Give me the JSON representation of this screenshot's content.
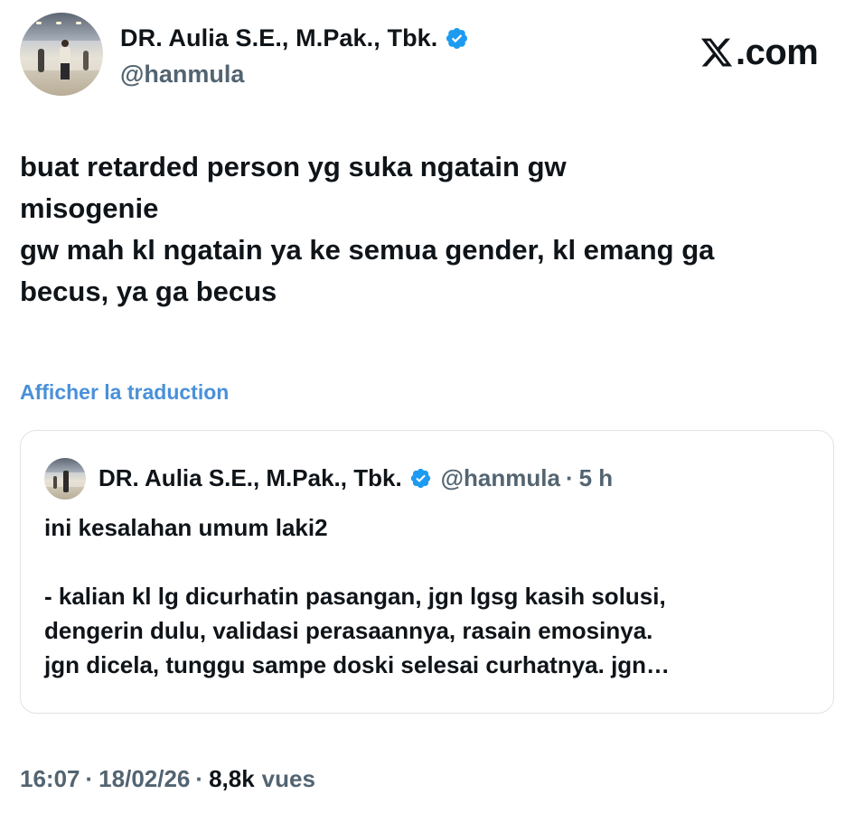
{
  "author": {
    "display_name": "DR. Aulia S.E., M.Pak., Tbk.",
    "handle": "@hanmula",
    "verified": true
  },
  "brand": {
    "site_label": ".com",
    "logo_icon": "x-logo-icon"
  },
  "tweet": {
    "text": "buat  retarded person yg suka ngatain gw\nmisogenie\ngw mah kl ngatain ya ke semua gender, kl emang ga\nbecus, ya ga becus",
    "translate_label": "Afficher la traduction"
  },
  "quote": {
    "display_name": "DR. Aulia S.E., M.Pak., Tbk.",
    "handle": "@hanmula",
    "separator": "·",
    "time": "5 h",
    "text": "ini kesalahan umum laki2\n\n- kalian kl lg dicurhatin pasangan, jgn lgsg kasih solusi,\ndengerin dulu, validasi perasaannya, rasain emosinya.\njgn dicela, tunggu sampe doski selesai curhatnya. jgn…"
  },
  "meta": {
    "time": "16:07",
    "separator": "·",
    "date": "18/02/26",
    "views_count": "8,8k",
    "views_label": "vues"
  },
  "colors": {
    "link": "#4a90d9",
    "verified": "#1d9bf0",
    "secondary_text": "#536471"
  }
}
